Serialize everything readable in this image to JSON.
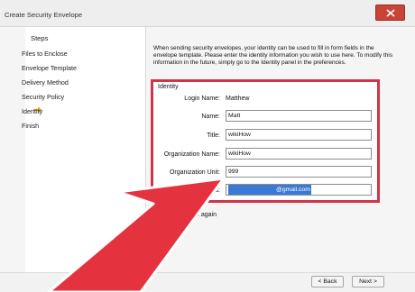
{
  "window": {
    "title": "Create Security Envelope"
  },
  "steps": {
    "heading": "Steps",
    "items": [
      {
        "label": "Files to Enclose"
      },
      {
        "label": "Envelope Template"
      },
      {
        "label": "Delivery Method"
      },
      {
        "label": "Security Policy"
      },
      {
        "label": "Identity",
        "current": true
      },
      {
        "label": "Finish"
      }
    ]
  },
  "main": {
    "instructions": "When sending security envelopes, your identity can be used to fill in form fields in the envelope template. Please enter the identity information you wish to use here. To modify this information in the future, simply go to the Identity panel in the preferences.",
    "identity": {
      "heading": "Identity",
      "login_label": "Login Name:",
      "login_value": "Matthew",
      "name_label": "Name:",
      "name_value": "Matt",
      "title_label": "Title:",
      "title_value": "wikiHow",
      "org_label": "Organization Name:",
      "org_value": "wikiHow",
      "unit_label": "Organization Unit:",
      "unit_value": "999",
      "email_label": "Email Address:",
      "email_value": "@gmail.com"
    },
    "checkbox_label": "Do not show again",
    "checkbox_checked": false
  },
  "buttons": {
    "back": "< Back",
    "next": "Next >"
  },
  "colors": {
    "highlight_box": "#d1334a",
    "arrow": "#e5323f",
    "selection": "#3a7ad6",
    "close_button": "#c74436"
  }
}
